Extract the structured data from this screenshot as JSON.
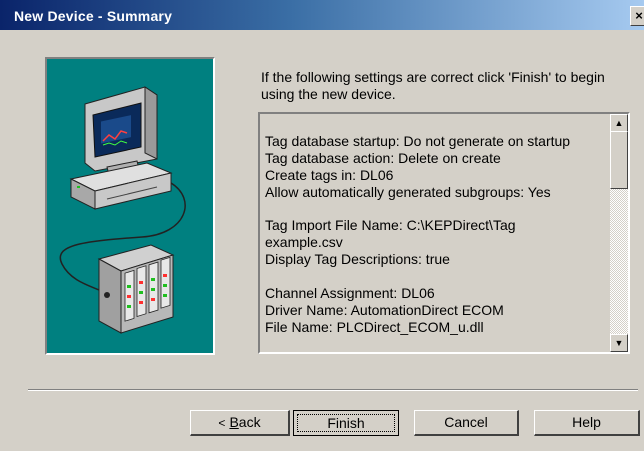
{
  "window": {
    "title": "New Device - Summary",
    "close_glyph": "×"
  },
  "instruction": "If the following settings are correct click 'Finish' to begin using the new device.",
  "summary": {
    "groups": [
      [
        "Tag database startup: Do not generate on startup",
        "Tag database action: Delete on create",
        "Create tags in: DL06",
        "Allow automatically generated subgroups: Yes"
      ],
      [
        "Tag Import File Name: C:\\KEPDirect\\Tag",
        "example.csv",
        "Display Tag Descriptions: true"
      ],
      [
        "Channel Assignment: DL06",
        "Driver Name: AutomationDirect ECOM",
        "File Name: PLCDirect_ECOM_u.dll"
      ]
    ]
  },
  "scrollbar": {
    "up_icon": "scroll-up-arrow-icon",
    "down_icon": "scroll-down-arrow-icon",
    "up_glyph": "▲",
    "down_glyph": "▼"
  },
  "buttons": {
    "back_arrow": "<",
    "back_mnemonic": "B",
    "back_rest": "ack",
    "finish": "Finish",
    "cancel": "Cancel",
    "help": "Help"
  },
  "illustration": {
    "icon": "computer-connected-to-plc-icon",
    "panel_color": "#008080"
  }
}
